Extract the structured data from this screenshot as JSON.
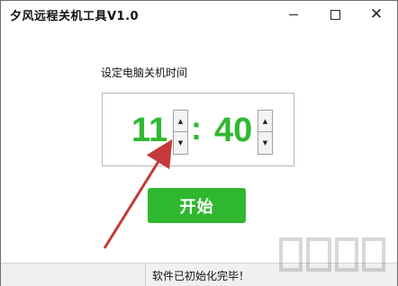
{
  "window": {
    "title": "夕风远程关机工具V1.0",
    "controls": {
      "minimize": "minimize-icon",
      "maximize": "maximize-icon",
      "close": "close-icon",
      "close_glyph": "✕"
    }
  },
  "main": {
    "label": "设定电脑关机时间",
    "hour": "11",
    "colon": ":",
    "minute": "40",
    "spin_up": "▲",
    "spin_down": "▼",
    "start_button": "开始"
  },
  "status": {
    "text": "软件已初始化完毕！"
  },
  "colors": {
    "accent": "#2fb82f",
    "arrow": "#c43a3a"
  }
}
